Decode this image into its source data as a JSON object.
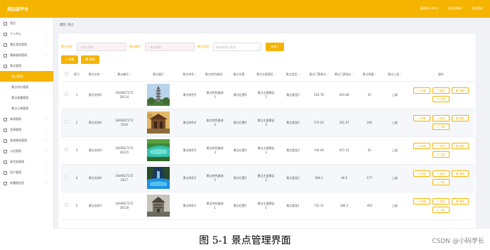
{
  "app": {
    "title": "周边游平台",
    "welcome": "管理员 admin",
    "exit_front": "退出到前台",
    "logout": "退出登录",
    "accent": "#f4b400"
  },
  "sidebar": {
    "items": [
      {
        "label": "首页",
        "has_arrow": false
      },
      {
        "label": "个人中心",
        "has_arrow": true
      },
      {
        "label": "景区类型管理",
        "has_arrow": true
      },
      {
        "label": "最新路线管理",
        "has_arrow": true
      },
      {
        "label": "景点管理",
        "has_arrow": true
      }
    ],
    "sub_items": [
      {
        "label": "景点管理",
        "active": true
      },
      {
        "label": "景点评价管理",
        "active": false
      },
      {
        "label": "景点收藏管理",
        "active": false
      },
      {
        "label": "景点订单管理",
        "active": false
      }
    ],
    "items_after": [
      {
        "label": "新闻管理"
      },
      {
        "label": "资源管理"
      },
      {
        "label": "旅游路线管理"
      },
      {
        "label": "公告管理"
      },
      {
        "label": "留言板管理"
      },
      {
        "label": "用户管理"
      },
      {
        "label": "轮播图信息"
      }
    ]
  },
  "breadcrumb": {
    "home": "首页",
    "sep": "/",
    "current": "景点"
  },
  "filters": {
    "name_label": "景点名称",
    "name_placeholder": "景点名称",
    "id_label": "景点编号",
    "id_placeholder": "景点编号",
    "status_label": "景点状态",
    "status_placeholder": "请选择景点状态",
    "query_label": "查询"
  },
  "actions": {
    "add_label": "新增",
    "delete_label": "删除"
  },
  "table": {
    "headers": [
      "索引",
      "景点名称",
      "景点编号",
      "景点图片",
      "景点特色",
      "景点特色路线",
      "景点位置",
      "景点主要景区",
      "景点类型",
      "景点门票原价",
      "景点门票现价",
      "景点销量",
      "景点上架",
      "操作"
    ],
    "rows": [
      {
        "index": "1",
        "name": "景点名称5",
        "code": "1649827272\n29114",
        "feature": "景点特色5",
        "route": "景点特色路线\n5",
        "location": "景点位置5",
        "main_area": "景点主要景区\n5",
        "type": "景点类型5",
        "orig_price": "554.76",
        "cur_price": "493.86",
        "sales": "55",
        "status": "上架",
        "img": "pagoda"
      },
      {
        "index": "2",
        "name": "景点名称4",
        "code": "1649827272\n2916",
        "feature": "景点特色4",
        "route": "景点特色路线\n4",
        "location": "景点位置4",
        "main_area": "景点主要景区\n4",
        "type": "景点类型4",
        "orig_price": "574.02",
        "cur_price": "181.07",
        "sales": "246",
        "status": "上架",
        "img": "palace"
      },
      {
        "index": "3",
        "name": "景点名称3",
        "code": "1649827272\n29115",
        "feature": "景点特色3",
        "route": "景点特色路线\n3",
        "location": "景点位置3",
        "main_area": "景点主要景区\n3",
        "type": "景点类型3",
        "orig_price": "744.06",
        "cur_price": "457.31",
        "sales": "42",
        "status": "上架",
        "img": "lake"
      },
      {
        "index": "4",
        "name": "景点名称2",
        "code": "1649827272\n2917",
        "feature": "景点特色2",
        "route": "景点特色路线\n2",
        "location": "景点位置2",
        "main_area": "景点主要景区\n2",
        "type": "景点类型2",
        "orig_price": "586.2",
        "cur_price": "46.6",
        "sales": "177",
        "status": "上架",
        "img": "valley"
      },
      {
        "index": "5",
        "name": "景点名称1",
        "code": "1649827272\n29119",
        "feature": "景点特色1",
        "route": "景点特色路线\n1",
        "location": "景点位置1",
        "main_area": "景点主要景区\n1",
        "type": "景点类型1",
        "orig_price": "735.11",
        "cur_price": "384.2",
        "sales": "459",
        "status": "上架",
        "img": "tower"
      }
    ],
    "op_labels": {
      "detail": "详情",
      "edit": "修改",
      "delete": "删除",
      "off": "下架"
    }
  },
  "caption": "图 5-1 景点管理界面",
  "watermark": "CSDN @小码学长"
}
